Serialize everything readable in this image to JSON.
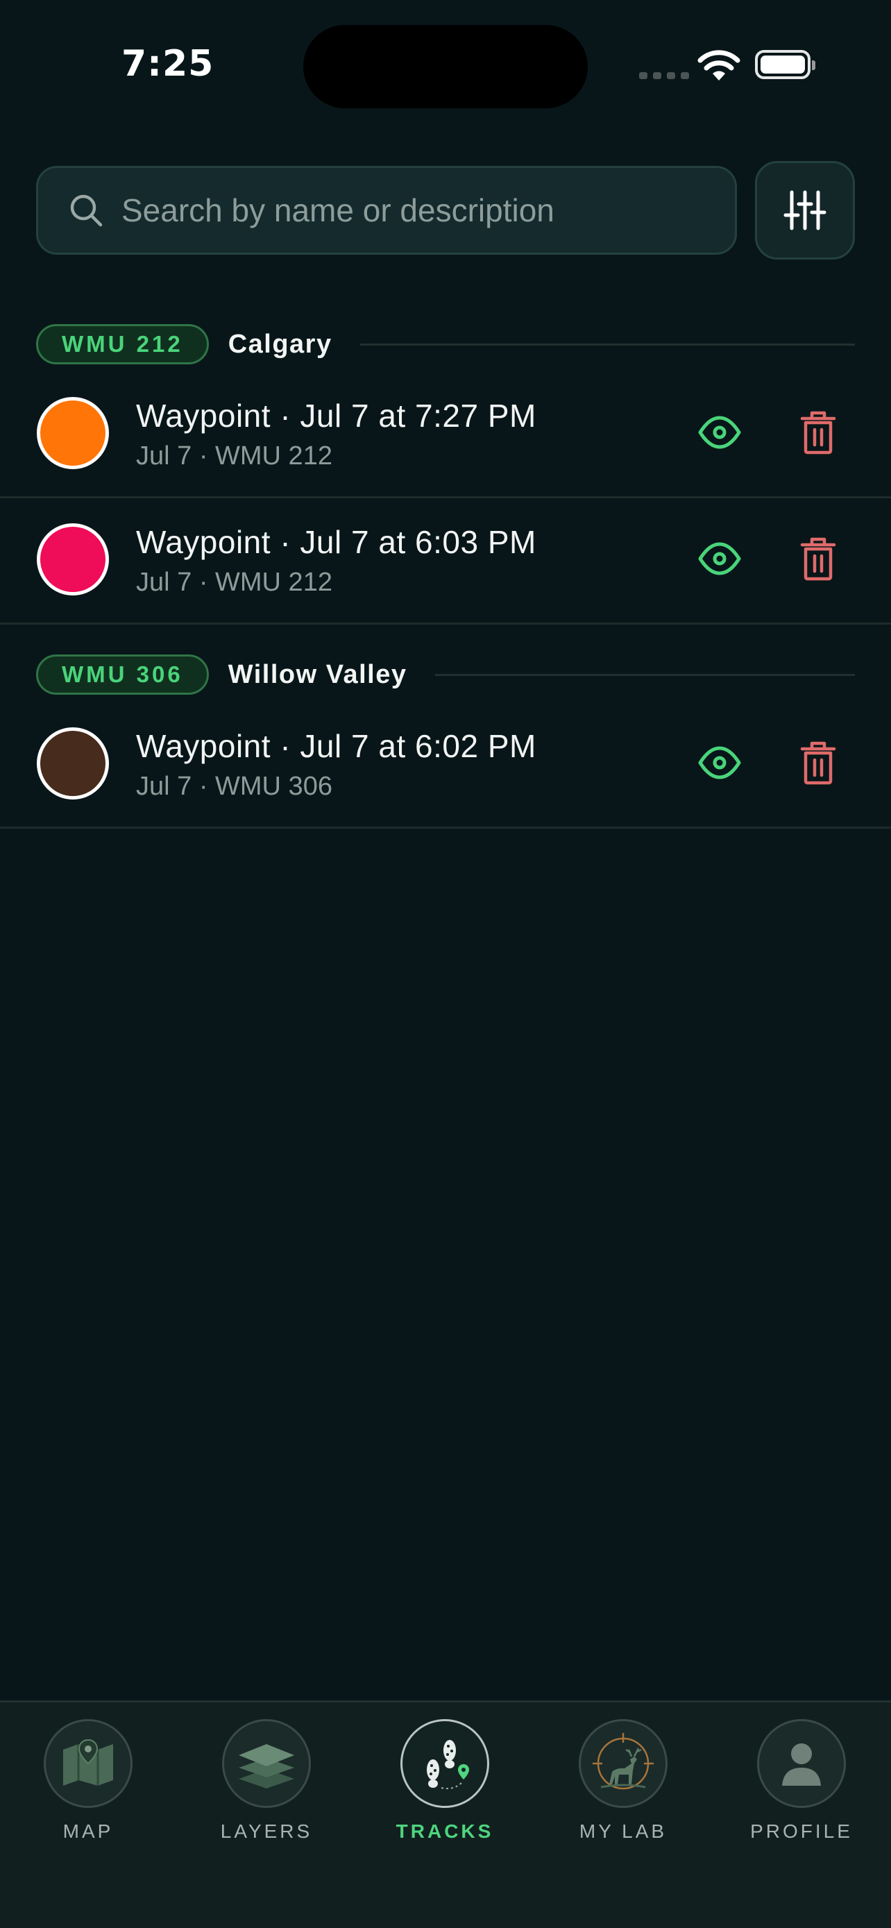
{
  "status_bar": {
    "time": "7:25"
  },
  "search": {
    "placeholder": "Search by name or description",
    "value": ""
  },
  "sections": [
    {
      "badge": "WMU 212",
      "place": "Calgary",
      "items": [
        {
          "title": "Waypoint · Jul 7 at 7:27 PM",
          "subtitle": "Jul 7 · WMU 212",
          "color": "#ff7508"
        },
        {
          "title": "Waypoint · Jul 7 at 6:03 PM",
          "subtitle": "Jul 7 · WMU 212",
          "color": "#ef0c58"
        }
      ]
    },
    {
      "badge": "WMU 306",
      "place": "Willow Valley",
      "items": [
        {
          "title": "Waypoint · Jul 7 at 6:02 PM",
          "subtitle": "Jul 7 · WMU 306",
          "color": "#472b1c"
        }
      ]
    }
  ],
  "tabs": [
    {
      "label": "MAP",
      "icon": "map-icon"
    },
    {
      "label": "LAYERS",
      "icon": "layers-icon"
    },
    {
      "label": "TRACKS",
      "icon": "footprints-icon",
      "active": true
    },
    {
      "label": "MY LAB",
      "icon": "deer-crosshair-icon"
    },
    {
      "label": "PROFILE",
      "icon": "profile-icon"
    }
  ],
  "colors": {
    "accent": "#4ad47b",
    "danger": "#e06b6b",
    "background": "#081619"
  }
}
